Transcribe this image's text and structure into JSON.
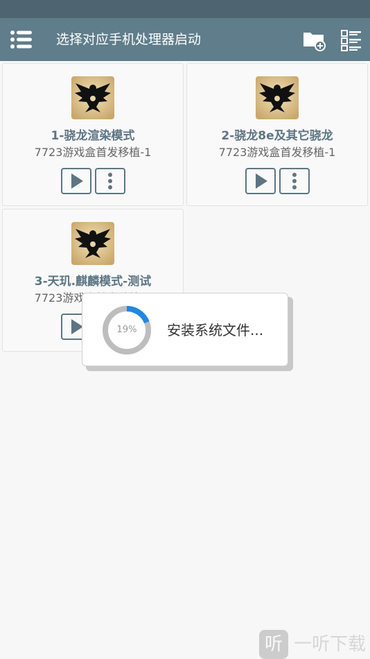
{
  "app": {
    "title": "选择对应手机处理器启动"
  },
  "icons": {
    "menu": "menu-list-icon",
    "folder_add": "folder-add-icon",
    "list_view": "list-view-icon",
    "game": "eagle-emblem-icon",
    "play": "play-icon",
    "more": "more-vertical-icon"
  },
  "colors": {
    "statusbar": "#4e6470",
    "appbar": "#607d8b",
    "card_title": "#5d7583",
    "spinner_progress": "#1e88e5",
    "spinner_track": "#bdbdbd"
  },
  "cards": [
    {
      "title": "1-骁龙渲染模式",
      "subtitle": "7723游戏盒首发移植-1"
    },
    {
      "title": "2-骁龙8e及其它骁龙",
      "subtitle": "7723游戏盒首发移植-1"
    },
    {
      "title": "3-天玑.麒麟模式-测试",
      "subtitle": "7723游戏盒首发移植-1"
    }
  ],
  "dialog": {
    "progress_text": "19%",
    "progress_value": 19,
    "message": "安装系统文件..."
  },
  "watermark": {
    "logo_char": "听",
    "text": "一听下载"
  }
}
